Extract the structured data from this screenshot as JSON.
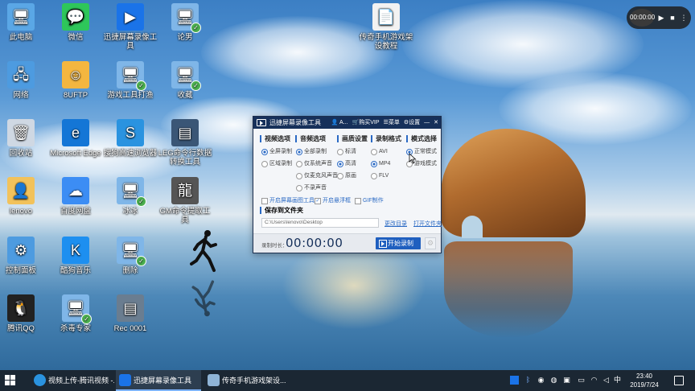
{
  "desktop": {
    "icons": [
      {
        "label": "此电脑",
        "icon": "computer-icon",
        "color": "#5aa7e6"
      },
      {
        "label": "微信",
        "icon": "wechat-icon",
        "color": "#2ec65a"
      },
      {
        "label": "迅捷屏幕录像工具",
        "icon": "screen-recorder-icon",
        "color": "#1a73e8"
      },
      {
        "label": "论男",
        "icon": "app-shortcut-icon",
        "color": "#7fb6e8"
      },
      {
        "label": "网络",
        "icon": "network-icon",
        "color": "#4d9be0"
      },
      {
        "label": "8UFTP",
        "icon": "ftp-icon",
        "color": "#f4b63f"
      },
      {
        "label": "游戏工具打渔",
        "icon": "app-shortcut-icon",
        "color": "#7fb6e8"
      },
      {
        "label": "收藏",
        "icon": "app-shortcut-icon",
        "color": "#7fb6e8"
      },
      {
        "label": "回收站",
        "icon": "recycle-bin-icon",
        "color": "#cfd8e3"
      },
      {
        "label": "Microsoft Edge",
        "icon": "edge-icon",
        "color": "#1476d6"
      },
      {
        "label": "搜狗高速浏览器",
        "icon": "sogou-browser-icon",
        "color": "#2a93e0"
      },
      {
        "label": "LEG命令行数据转换工具",
        "icon": "video-file-icon",
        "color": "#3a5676"
      },
      {
        "label": "lenovo",
        "icon": "user-folder-icon",
        "color": "#f2c25b"
      },
      {
        "label": "百度网盘",
        "icon": "baidu-netdisk-icon",
        "color": "#3c8df4"
      },
      {
        "label": "冰冰",
        "icon": "app-shortcut-icon",
        "color": "#7fb6e8"
      },
      {
        "label": "GM命令提取工具",
        "icon": "dragon-app-icon",
        "color": "#555555"
      },
      {
        "label": "控制面板",
        "icon": "control-panel-icon",
        "color": "#4d9be0"
      },
      {
        "label": "酷狗音乐",
        "icon": "kugou-icon",
        "color": "#1d8ff0"
      },
      {
        "label": "删除",
        "icon": "app-shortcut-icon",
        "color": "#7fb6e8"
      },
      {
        "label": "腾讯QQ",
        "icon": "qq-icon",
        "color": "#222222"
      },
      {
        "label": "杀毒专家",
        "icon": "app-shortcut-icon",
        "color": "#7fb6e8"
      },
      {
        "label": "Rec 0001",
        "icon": "video-file-icon",
        "color": "#6a7d90"
      },
      {
        "label": "传奇手机游戏架设教程",
        "icon": "text-document-icon",
        "color": "#f2f2f2"
      }
    ]
  },
  "mini_recorder": {
    "time": "00:00:00"
  },
  "recorder": {
    "title": "迅捷屏幕录像工具",
    "account": "A...",
    "vip": "购买VIP",
    "menu": "菜单",
    "settings": "设置",
    "sections": {
      "video": "视频选项",
      "audio": "音频选项",
      "quality": "画质设置",
      "format": "录制格式",
      "mode": "模式选择"
    },
    "video_options": [
      "全屏录制",
      "区域录制"
    ],
    "audio_options": [
      "全部录制",
      "仅系统声音",
      "仅麦克风声音",
      "不录声音"
    ],
    "quality_options": [
      "标清",
      "高清",
      "原画"
    ],
    "format_options": [
      "AVI",
      "MP4",
      "FLV"
    ],
    "mode_options": [
      "正常模式",
      "游戏模式"
    ],
    "checkboxes": [
      "开启屏幕画图工具",
      "开启悬浮框",
      "GIF制作"
    ],
    "save_folder_label": "保存到文件夹",
    "save_path": "C:\\Users\\lenovo\\Desktop",
    "change_dir": "更改目录",
    "open_folder": "打开文件夹",
    "record_time_label": "录制时长：",
    "record_time": "00:00:00",
    "start_button": "开始录制"
  },
  "taskbar": {
    "tasks": [
      "视频上传-腾讯视频 -...",
      "迅捷屏幕录像工具",
      "传奇手机游戏架设..."
    ],
    "ime": "中",
    "time": "23:40",
    "date": "2019/7/24"
  }
}
